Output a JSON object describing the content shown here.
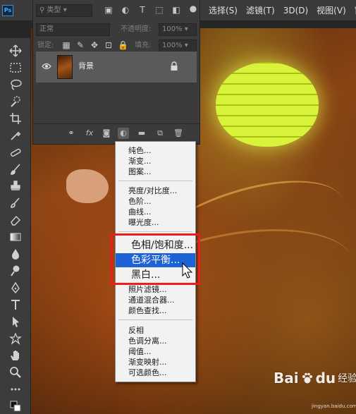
{
  "app": {
    "logo_text": "Ps"
  },
  "menubar": {
    "items": [
      "选择(S)",
      "滤镜(T)",
      "3D(D)",
      "视图(V)",
      "窗"
    ]
  },
  "toolbar": {
    "tools": [
      "move-tool",
      "marquee-tool",
      "lasso-tool",
      "quick-select-tool",
      "crop-tool",
      "eyedropper-tool",
      "healing-brush-tool",
      "brush-tool",
      "clone-stamp-tool",
      "history-brush-tool",
      "eraser-tool",
      "gradient-tool",
      "blur-tool",
      "dodge-tool",
      "pen-tool",
      "type-tool",
      "path-select-tool",
      "shape-tool",
      "hand-tool",
      "zoom-tool",
      "more-tools"
    ]
  },
  "layers_panel": {
    "filter_placeholder": "类型",
    "blend_mode": "正常",
    "opacity_label": "不透明度:",
    "opacity_value": "100%",
    "lock_label": "锁定:",
    "fill_label": "填充:",
    "fill_value": "100%",
    "layer_name": "背景",
    "footer_fx": "fx"
  },
  "context_menu": {
    "group1": [
      "纯色...",
      "渐变...",
      "图案..."
    ],
    "group2": [
      "亮度/对比度...",
      "色阶...",
      "曲线...",
      "曝光度..."
    ],
    "group3": [
      "色相/饱和度...",
      "色彩平衡...",
      "黑白..."
    ],
    "group3_selected": "色彩平衡...",
    "group3b": [
      "照片滤镜...",
      "通道混合器...",
      "颜色查找..."
    ],
    "group4": [
      "反相",
      "色调分离...",
      "阈值...",
      "渐变映射...",
      "可选颜色..."
    ]
  },
  "watermark": {
    "brand": "Bai",
    "brand2": "du",
    "sub": "经验",
    "url": "jingyan.baidu.com"
  },
  "colors": {
    "selection": "#1d63d6",
    "highlight_box": "#ee1c1c",
    "menu_bg": "#f2f2f2"
  }
}
